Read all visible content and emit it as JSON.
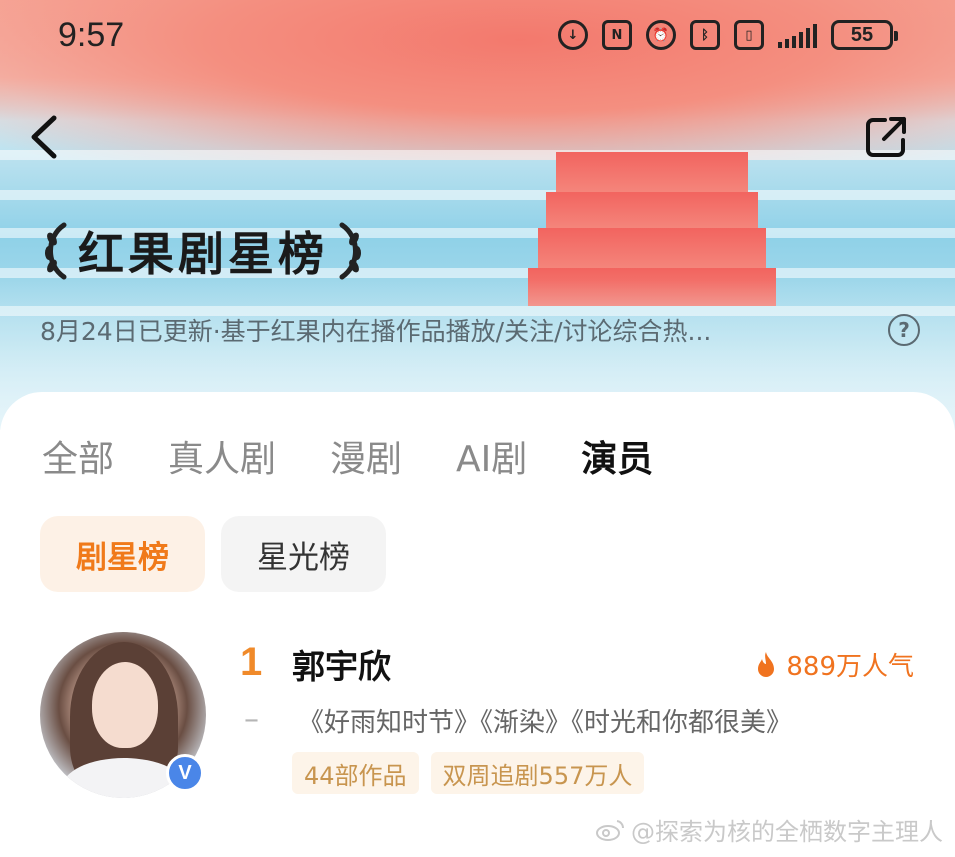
{
  "status_bar": {
    "time": "9:57",
    "battery": "55"
  },
  "header": {
    "title": "红果剧星榜",
    "subtitle": "8月24日已更新·基于红果内在播作品播放/关注/讨论综合热...",
    "help": "?"
  },
  "tabs": [
    {
      "label": "全部",
      "active": false
    },
    {
      "label": "真人剧",
      "active": false
    },
    {
      "label": "漫剧",
      "active": false
    },
    {
      "label": "AI剧",
      "active": false
    },
    {
      "label": "演员",
      "active": true
    }
  ],
  "subtabs": [
    {
      "label": "剧星榜",
      "active": true
    },
    {
      "label": "星光榜",
      "active": false
    }
  ],
  "ranking": [
    {
      "rank": "1",
      "change": "–",
      "name": "郭宇欣",
      "popularity": "889万人气",
      "works": "《好雨知时节》《渐染》《时光和你都很美》",
      "tags": [
        "44部作品",
        "双周追剧557万人"
      ],
      "verified_badge": "V"
    }
  ],
  "watermark": "@探索为核的全栖数字主理人",
  "colors": {
    "accent": "#f07a1a",
    "tag_bg": "#fdf4e9",
    "tag_text": "#c8954f",
    "verified": "#4a86e8"
  },
  "icons": [
    "back-arrow-icon",
    "share-icon",
    "help-icon",
    "fire-icon",
    "verified-icon",
    "laurel-icon",
    "weibo-icon"
  ]
}
